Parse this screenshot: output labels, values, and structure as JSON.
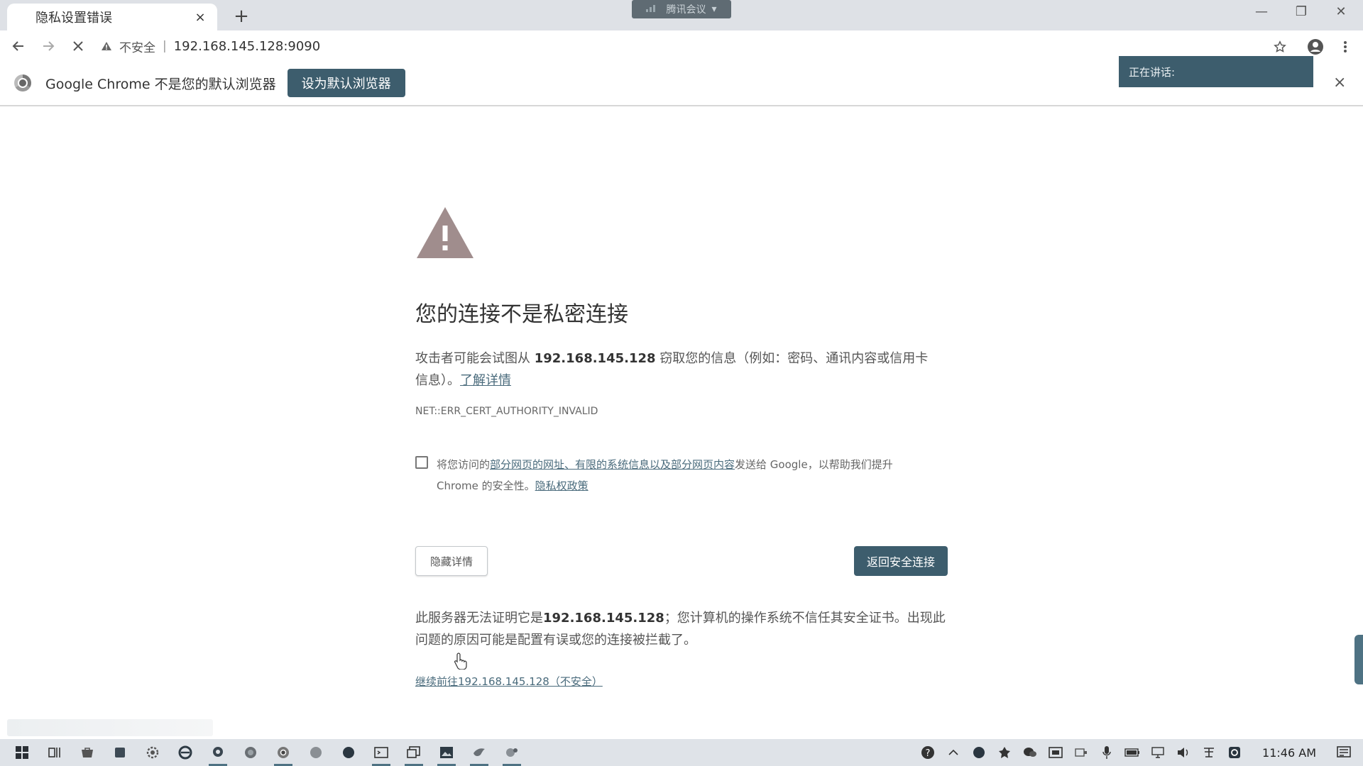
{
  "browser": {
    "tab_title": "隐私设置错误",
    "tab_close": "×",
    "new_tab": "+",
    "meeting_app": "腾讯会议",
    "meeting_caret": "▾",
    "minimize": "—",
    "restore": "❐",
    "close": "✕",
    "omnibox_status": "不安全",
    "omnibox_separator": "|",
    "url": "192.168.145.128:9090"
  },
  "infobar": {
    "message": "Google Chrome 不是您的默认浏览器",
    "set_default_label": "设为默认浏览器",
    "speaking_label": "正在讲话:",
    "close_label": "×"
  },
  "interstitial": {
    "heading": "您的连接不是私密连接",
    "desc_prefix": "攻击者可能会试图从 ",
    "desc_host": "192.168.145.128",
    "desc_suffix": " 窃取您的信息（例如：密码、通讯内容或信用卡信息）。",
    "learn_more": "了解详情",
    "error_code": "NET::ERR_CERT_AUTHORITY_INVALID",
    "checkbox_prefix": "将您访问的",
    "checkbox_link": "部分网页的网址、有限的系统信息以及部分网页内容",
    "checkbox_suffix": "发送给 Google，以帮助我们提升 Chrome 的安全性。",
    "privacy_policy": "隐私权政策",
    "hide_details": "隐藏详情",
    "back_to_safety": "返回安全连接",
    "details_prefix": "此服务器无法证明它是",
    "details_host": "192.168.145.128",
    "details_suffix": "；您计算机的操作系统不信任其安全证书。出现此问题的原因可能是配置有误或您的连接被拦截了。",
    "proceed_link": "继续前往192.168.145.128（不安全）"
  },
  "taskbar": {
    "clock": "11:46 AM"
  },
  "colors": {
    "accent": "#3d5d6d",
    "warning_triangle": "#a08d8d",
    "taskbar_bg": "#dfe3e8"
  }
}
